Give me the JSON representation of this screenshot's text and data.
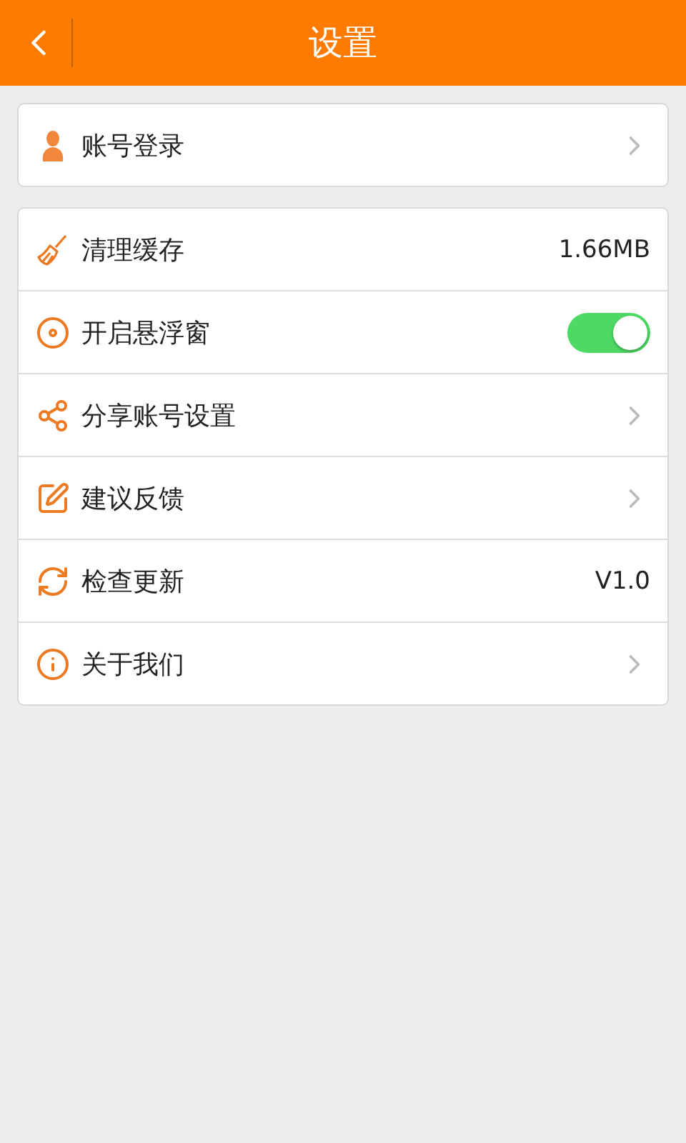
{
  "header": {
    "title": "设置"
  },
  "sections": [
    {
      "rows": [
        {
          "label": "账号登录",
          "kind": "link"
        }
      ]
    },
    {
      "rows": [
        {
          "label": "清理缓存",
          "kind": "value",
          "value": "1.66MB"
        },
        {
          "label": "开启悬浮窗",
          "kind": "toggle",
          "on": true
        },
        {
          "label": "分享账号设置",
          "kind": "link"
        },
        {
          "label": "建议反馈",
          "kind": "link"
        },
        {
          "label": "检查更新",
          "kind": "value",
          "value": "V1.0"
        },
        {
          "label": "关于我们",
          "kind": "link"
        }
      ]
    }
  ]
}
